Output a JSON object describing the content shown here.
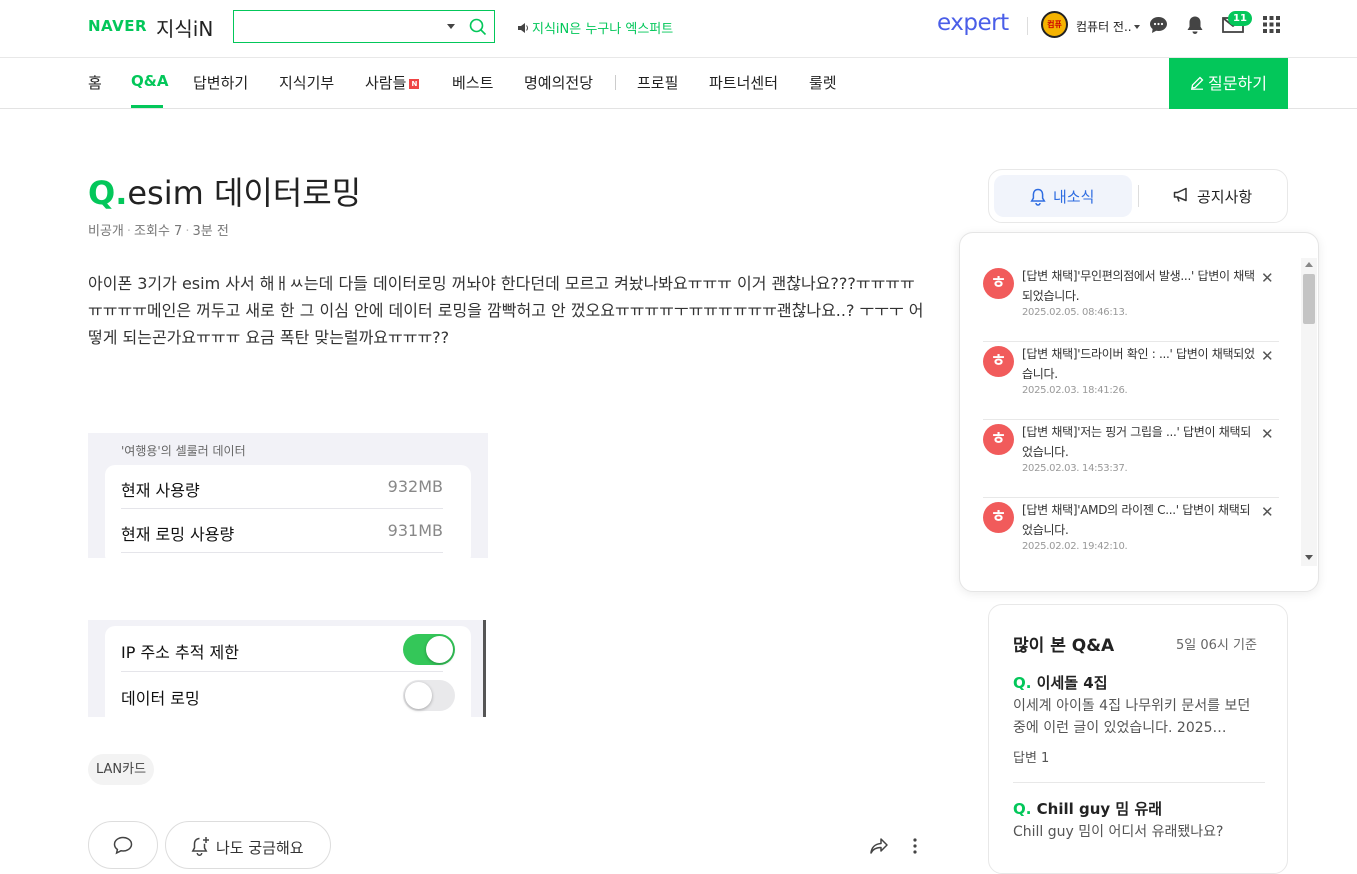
{
  "header": {
    "naver_logo": "NAVER",
    "service_logo": "지식iN",
    "search": {
      "value": "",
      "placeholder": ""
    },
    "promo_text": "지식iN은 누구나 엑스퍼트",
    "expert_logo": "expert",
    "avatar_text": "컴퓨",
    "username": "컴퓨터 전..",
    "mail_count": "11"
  },
  "nav": {
    "items": [
      "홈",
      "Q&A",
      "답변하기",
      "지식기부",
      "사람들",
      "베스트",
      "명예의전당",
      "프로필",
      "파트너센터",
      "룰렛"
    ],
    "new_badge": "N",
    "ask_button": "질문하기"
  },
  "question": {
    "q_mark": "Q.",
    "title": "esim 데이터로밍",
    "visibility": "비공개",
    "views": "조회수 7",
    "time": "3분 전",
    "body": "아이폰 3기가 esim 사서 해ㅐㅆ는데 다들 데이터로밍 꺼놔야 한다던데 모르고 켜놨나봐요ㅠㅠㅠ 이거 괜찮나요???ㅠㅠㅠㅠㅠㅠㅠㅠ메인은 꺼두고 새로 한 그 이심 안에 데이터 로밍을 깜빡허고 안 껐오요ㅠㅠㅠㅠㅜㅠㅠㅠㅠㅠㅠ괜찮나요..? ㅜㅜㅜ 어떻게 되는곤가요ㅠㅠㅠ 요금 폭탄 맞는럴까요ㅠㅠㅠ??",
    "screenshot1": {
      "header": "'여행용'의 셀룰러 데이터",
      "rows": [
        {
          "label": "현재 사용량",
          "value": "932MB"
        },
        {
          "label": "현재 로밍 사용량",
          "value": "931MB"
        }
      ]
    },
    "screenshot2": {
      "rows": [
        {
          "label": "IP 주소 추적 제한",
          "on": true
        },
        {
          "label": "데이터 로밍",
          "on": false
        }
      ]
    },
    "tag": "LAN카드",
    "curious_button": "나도 궁금해요"
  },
  "sidebar": {
    "tabs": {
      "mine": "내소식",
      "notice": "공지사항"
    },
    "notifications": [
      {
        "text": "[답변 채택]'무인편의점에서 발생...' 답변이 채택되었습니다.",
        "date": "2025.02.05. 08:46:13."
      },
      {
        "text": "[답변 채택]'드라이버 확인 : ...' 답변이 채택되었습니다.",
        "date": "2025.02.03. 18:41:26."
      },
      {
        "text": "[답변 채택]'저는 핑거 그립을 ...' 답변이 채택되었습니다.",
        "date": "2025.02.03. 14:53:37."
      },
      {
        "text": "[답변 채택]'AMD의 라이젠 C...' 답변이 채택되었습니다.",
        "date": "2025.02.02. 19:42:10."
      }
    ],
    "popular": {
      "title": "많이 본 Q&A",
      "basis": "5일 06시 기준",
      "items": [
        {
          "title": "이세돌 4집",
          "body": "이세계 아이돌 4집 나무위키 문서를 보던 중에 이런 글이 있었습니다. 2025…",
          "answers": "답변 1"
        },
        {
          "title": "Chill guy 밈 유래",
          "body": "Chill guy 밈이 어디서 유래됐나요?"
        }
      ]
    }
  },
  "colors": {
    "brand_green": "#03c75a",
    "expert_blue": "#4a5ee8",
    "notif_red": "#f15b5b"
  }
}
